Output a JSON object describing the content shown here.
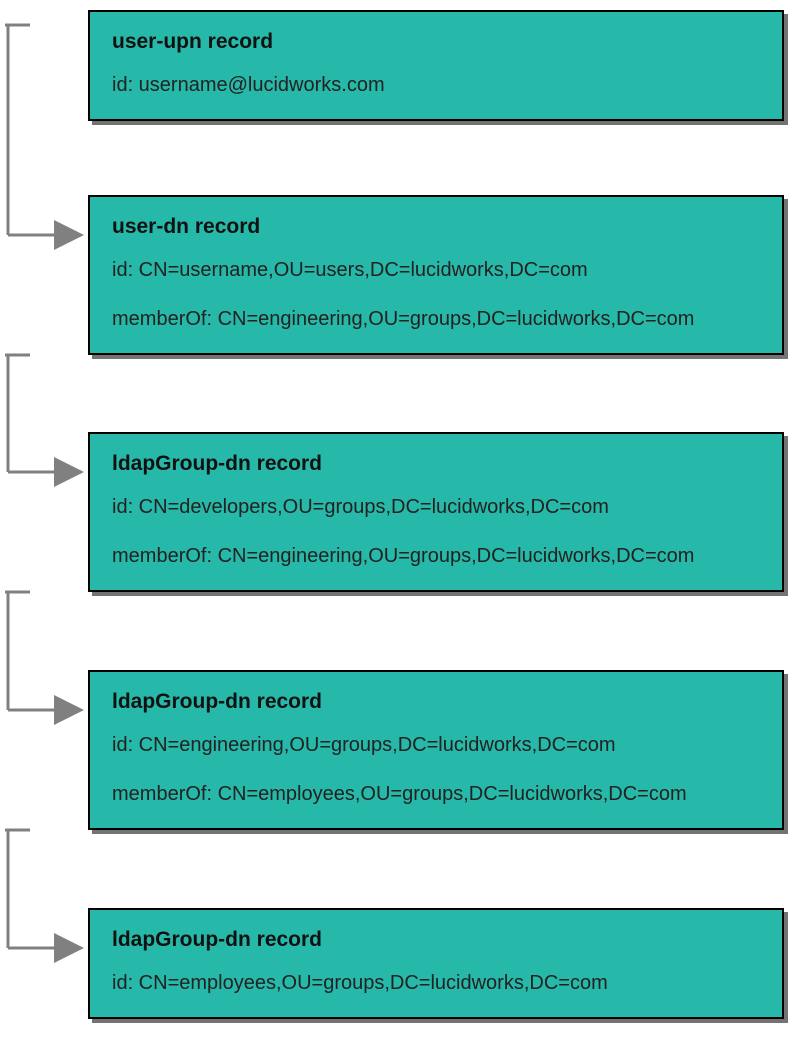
{
  "colors": {
    "box_fill": "#26b8a8",
    "connector": "#808080"
  },
  "boxes": [
    {
      "title": "user-upn record",
      "id_line": "id: username@lucidworks.com",
      "memberof_line": ""
    },
    {
      "title": "user-dn record",
      "id_line": "id: CN=username,OU=users,DC=lucidworks,DC=com",
      "memberof_line": "memberOf: CN=engineering,OU=groups,DC=lucidworks,DC=com"
    },
    {
      "title": "ldapGroup-dn record",
      "id_line": "id: CN=developers,OU=groups,DC=lucidworks,DC=com",
      "memberof_line": "memberOf: CN=engineering,OU=groups,DC=lucidworks,DC=com"
    },
    {
      "title": "ldapGroup-dn record",
      "id_line": "id: CN=engineering,OU=groups,DC=lucidworks,DC=com",
      "memberof_line": "memberOf: CN=employees,OU=groups,DC=lucidworks,DC=com"
    },
    {
      "title": "ldapGroup-dn record",
      "id_line": "id: CN=employees,OU=groups,DC=lucidworks,DC=com",
      "memberof_line": ""
    }
  ]
}
